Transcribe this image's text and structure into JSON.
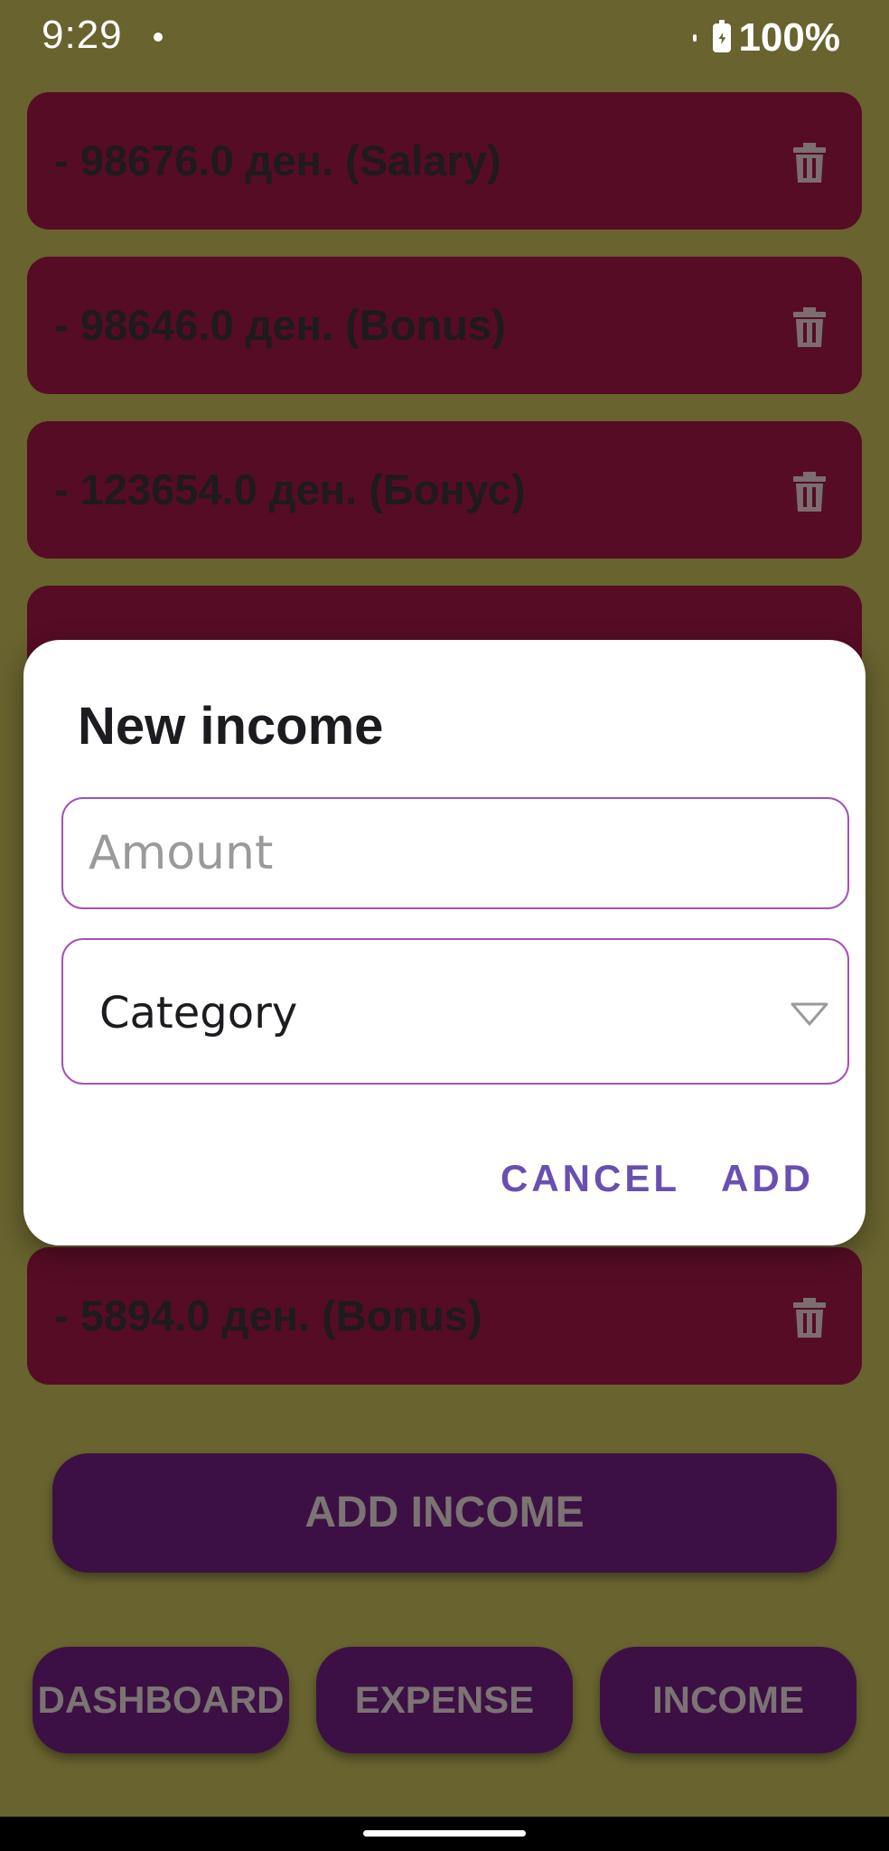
{
  "status_bar": {
    "time": "9:29",
    "battery": "100%"
  },
  "list": {
    "items": [
      {
        "label": "- 98676.0 ден. (Salary)",
        "action_icon": "trash-icon"
      },
      {
        "label": "- 98646.0 ден. (Bonus)",
        "action_icon": "trash-icon"
      },
      {
        "label": "- 123654.0 ден. (Бонус)",
        "action_icon": "trash-icon"
      },
      {
        "label": "",
        "action_icon": "trash-icon"
      },
      {
        "label": "- 5894.0 ден. (Bonus)",
        "action_icon": "trash-icon"
      }
    ]
  },
  "add_income_label": "ADD INCOME",
  "bottom_nav": {
    "dashboard": "DASHBOARD",
    "expense": "EXPENSE",
    "income": "INCOME"
  },
  "dialog": {
    "title": "New income",
    "amount": {
      "placeholder": "Amount",
      "value": ""
    },
    "category": {
      "selected": "Category",
      "icon": "dropdown-triangle-icon"
    },
    "cancel_label": "CANCEL",
    "add_label": "ADD"
  },
  "colors": {
    "background": "#68632f",
    "list_item": "#560c25",
    "button": "#3d1045",
    "dialog_accent": "#a352b7",
    "dialog_action": "#6a4fb2"
  }
}
